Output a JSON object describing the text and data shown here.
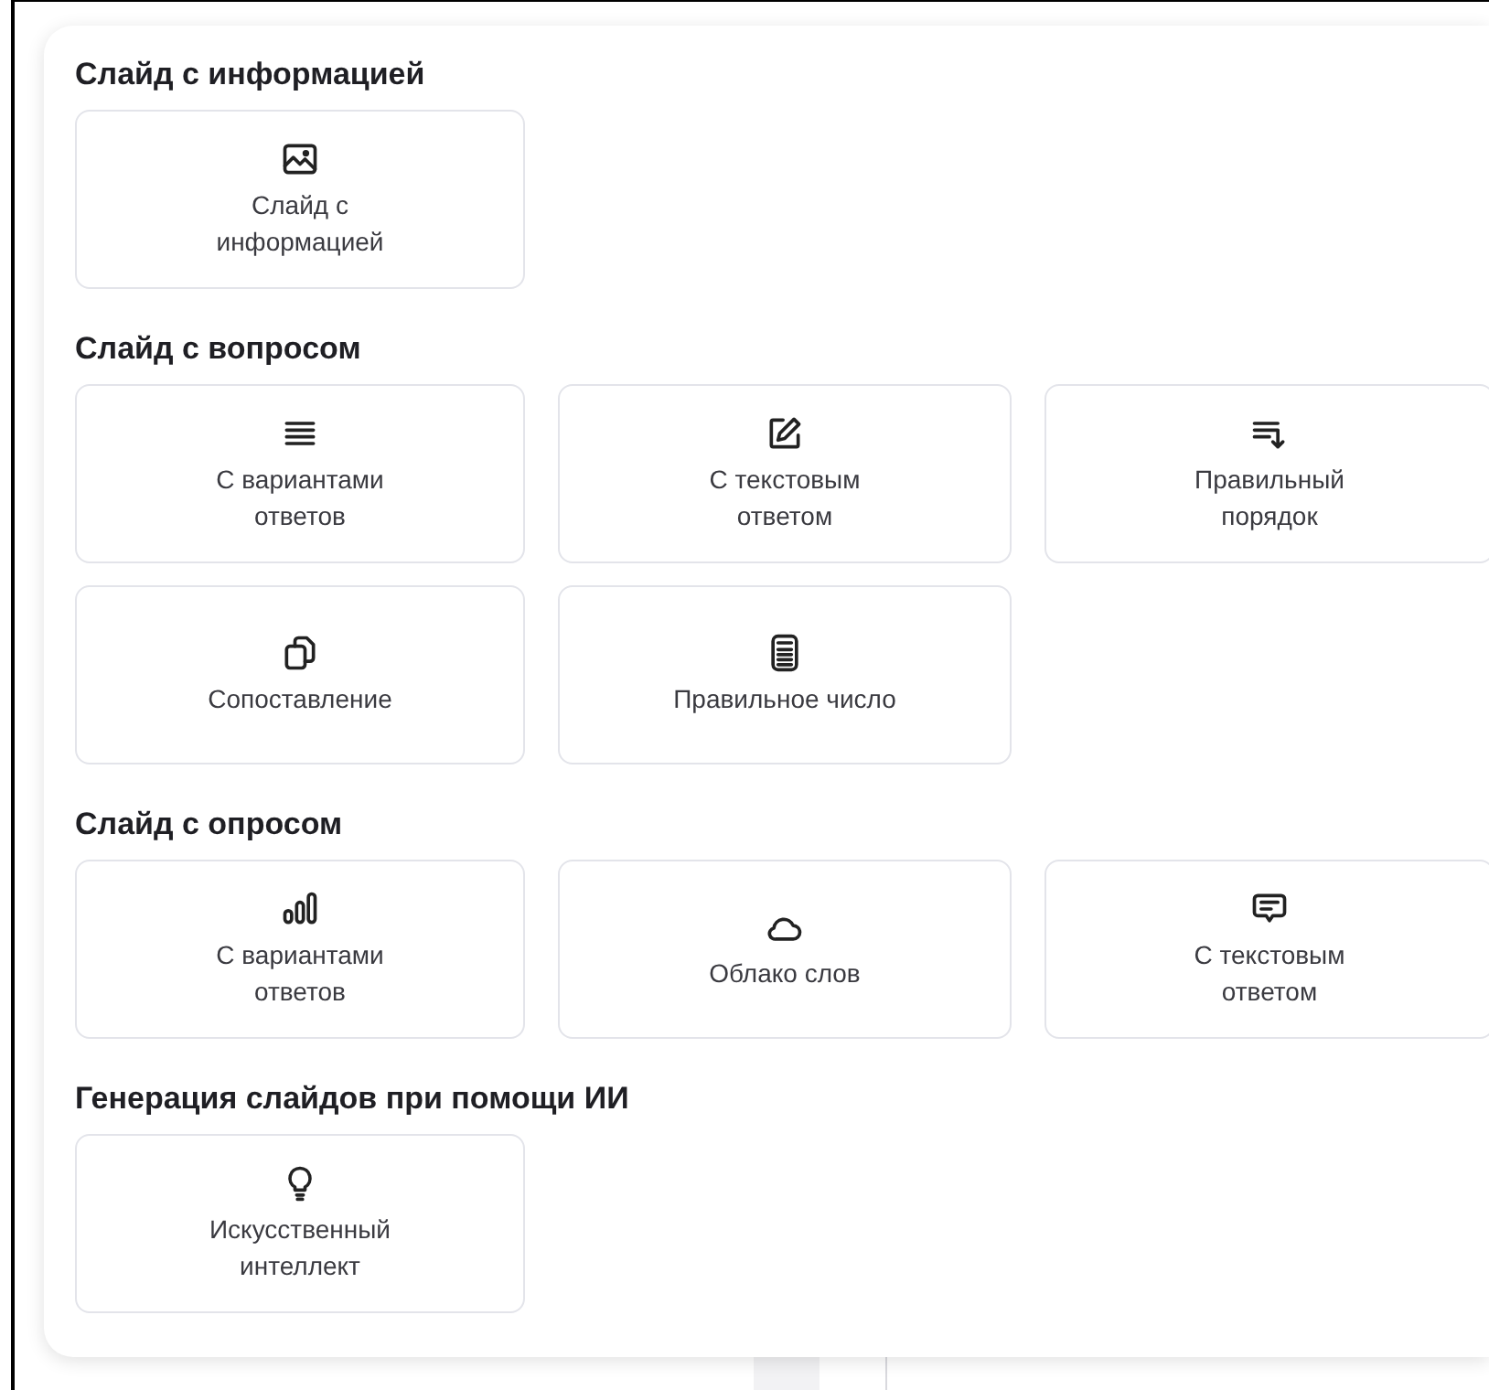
{
  "sections": [
    {
      "title": "Слайд с информацией",
      "items": [
        {
          "kind": "image",
          "label": "Слайд с информацией"
        }
      ]
    },
    {
      "title": "Слайд с вопросом",
      "items": [
        {
          "kind": "lines",
          "label": "С вариантами ответов"
        },
        {
          "kind": "pencil",
          "label": "С текстовым ответом"
        },
        {
          "kind": "sort",
          "label": "Правильный порядок"
        },
        {
          "kind": "copy",
          "label": "Сопоставление"
        },
        {
          "kind": "calc",
          "label": "Правильное число"
        }
      ]
    },
    {
      "title": "Слайд с опросом",
      "items": [
        {
          "kind": "bars",
          "label": "С вариантами ответов"
        },
        {
          "kind": "cloud",
          "label": "Облако слов"
        },
        {
          "kind": "chat",
          "label": "С текстовым ответом"
        }
      ]
    },
    {
      "title": "Генерация слайдов при помощи ИИ",
      "items": [
        {
          "kind": "bulb",
          "label": "Искусственный интеллект"
        }
      ]
    }
  ]
}
